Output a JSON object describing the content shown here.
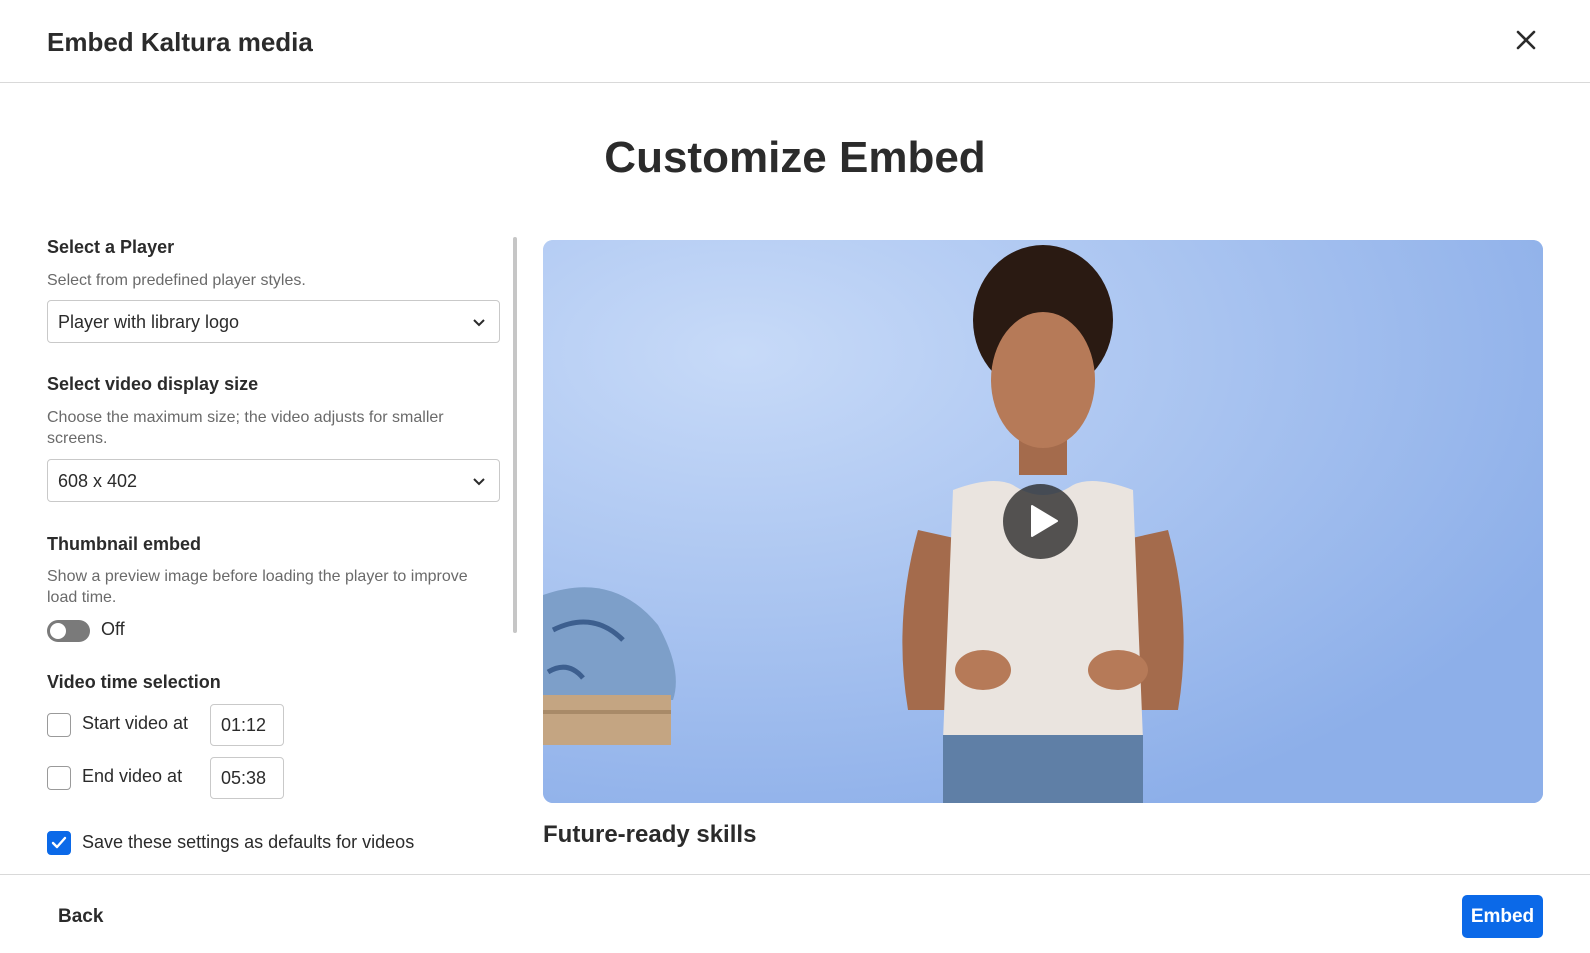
{
  "header": {
    "title": "Embed Kaltura media"
  },
  "page_title": "Customize Embed",
  "player": {
    "heading": "Select a Player",
    "description": "Select from predefined player styles.",
    "selected": "Player with library logo"
  },
  "display_size": {
    "heading": "Select video display size",
    "description": "Choose the maximum size; the video adjusts for smaller screens.",
    "selected": "608 x 402"
  },
  "thumbnail": {
    "heading": "Thumbnail embed",
    "description": "Show a preview image before loading the player to improve load time.",
    "toggle_state": "Off"
  },
  "time_selection": {
    "heading": "Video time selection",
    "start_label": "Start video at",
    "start_value": "01:12",
    "end_label": "End video at",
    "end_value": "05:38"
  },
  "defaults": {
    "label": "Save these settings as defaults for videos",
    "checked": true
  },
  "video": {
    "title": "Future-ready skills"
  },
  "footer": {
    "back_label": "Back",
    "embed_label": "Embed"
  }
}
